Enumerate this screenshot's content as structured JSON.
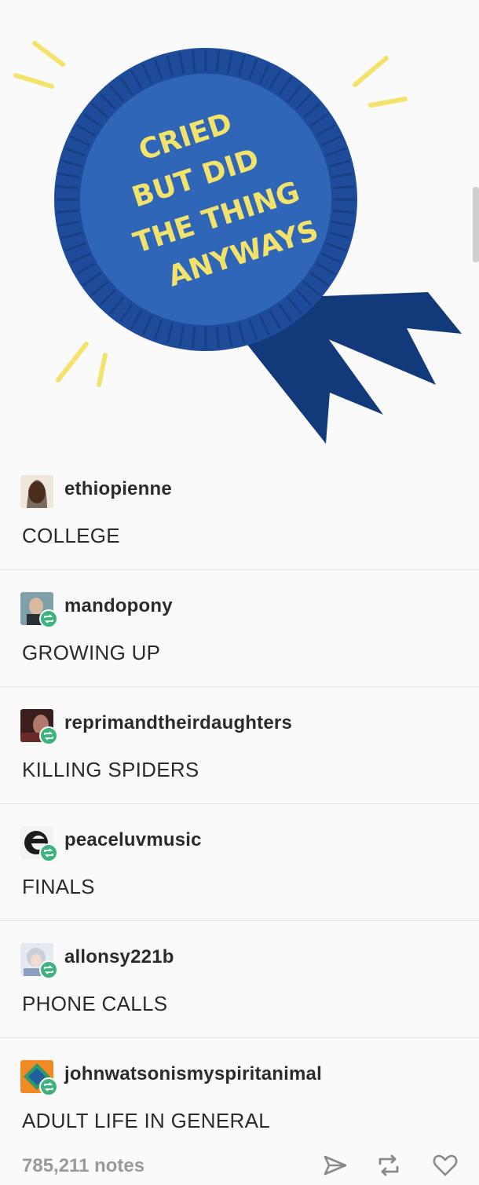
{
  "badge": {
    "lines": [
      "CRIED",
      "BUT DID",
      "THE THING",
      "ANYWAYS"
    ],
    "colors": {
      "outer_ring": "#1f4b9b",
      "inner_disc": "#2f66b8",
      "ribbon": "#123a7a",
      "text": "#f3e36a",
      "rays": "#f3e36a"
    }
  },
  "posts": [
    {
      "username": "ethiopienne",
      "text": "COLLEGE",
      "reblog": false
    },
    {
      "username": "mandopony",
      "text": "GROWING UP",
      "reblog": true
    },
    {
      "username": "reprimandtheirdaughters",
      "text": "KILLING SPIDERS",
      "reblog": true
    },
    {
      "username": "peaceluvmusic",
      "text": "FINALS",
      "reblog": true
    },
    {
      "username": "allonsy221b",
      "text": "PHONE CALLS",
      "reblog": true
    },
    {
      "username": "johnwatsonismyspiritanimal",
      "text": "ADULT LIFE IN GENERAL",
      "reblog": true
    }
  ],
  "footer": {
    "notes": "785,211 notes",
    "icons": [
      "share-icon",
      "reblog-icon",
      "heart-icon"
    ]
  },
  "colors": {
    "reblog_badge": "#3fb27f",
    "notes_text": "#9a9a9a",
    "divider": "#e3e3e3"
  }
}
